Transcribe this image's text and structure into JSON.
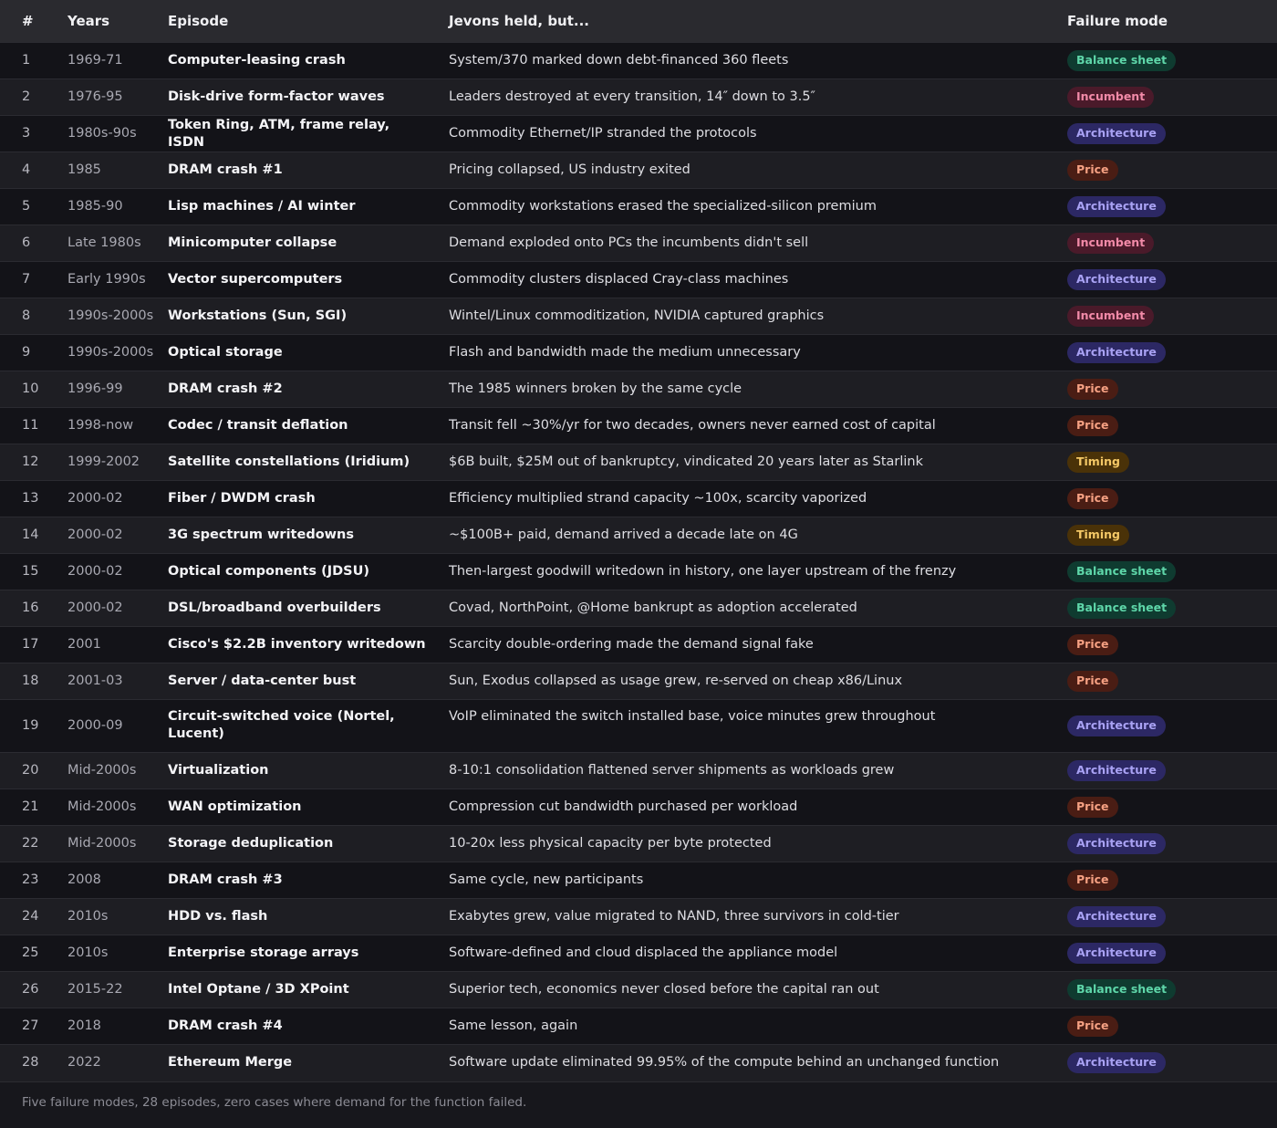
{
  "headers": {
    "num": "#",
    "years": "Years",
    "episode": "Episode",
    "desc": "Jevons held, but...",
    "mode": "Failure mode"
  },
  "colors": {
    "balance_sheet": "#5ed6a9",
    "incumbent": "#f28aa8",
    "architecture": "#a9a2f4",
    "price": "#f5a082",
    "timing": "#f4c866"
  },
  "rows": [
    {
      "num": "1",
      "years": "1969-71",
      "episode": "Computer-leasing crash",
      "desc": "System/370 marked down debt-financed 360 fleets",
      "mode": "Balance sheet",
      "mode_key": "balance"
    },
    {
      "num": "2",
      "years": "1976-95",
      "episode": "Disk-drive form-factor waves",
      "desc": "Leaders destroyed at every transition, 14″ down to 3.5″",
      "mode": "Incumbent",
      "mode_key": "incumbent"
    },
    {
      "num": "3",
      "years": "1980s-90s",
      "episode": "Token Ring, ATM, frame relay, ISDN",
      "desc": "Commodity Ethernet/IP stranded the protocols",
      "mode": "Architecture",
      "mode_key": "architecture"
    },
    {
      "num": "4",
      "years": "1985",
      "episode": "DRAM crash #1",
      "desc": "Pricing collapsed, US industry exited",
      "mode": "Price",
      "mode_key": "price"
    },
    {
      "num": "5",
      "years": "1985-90",
      "episode": "Lisp machines / AI winter",
      "desc": "Commodity workstations erased the specialized-silicon premium",
      "mode": "Architecture",
      "mode_key": "architecture"
    },
    {
      "num": "6",
      "years": "Late 1980s",
      "episode": "Minicomputer collapse",
      "desc": "Demand exploded onto PCs the incumbents didn't sell",
      "mode": "Incumbent",
      "mode_key": "incumbent"
    },
    {
      "num": "7",
      "years": "Early 1990s",
      "episode": "Vector supercomputers",
      "desc": "Commodity clusters displaced Cray-class machines",
      "mode": "Architecture",
      "mode_key": "architecture"
    },
    {
      "num": "8",
      "years": "1990s-2000s",
      "episode": "Workstations (Sun, SGI)",
      "desc": "Wintel/Linux commoditization, NVIDIA captured graphics",
      "mode": "Incumbent",
      "mode_key": "incumbent"
    },
    {
      "num": "9",
      "years": "1990s-2000s",
      "episode": "Optical storage",
      "desc": "Flash and bandwidth made the medium unnecessary",
      "mode": "Architecture",
      "mode_key": "architecture"
    },
    {
      "num": "10",
      "years": "1996-99",
      "episode": "DRAM crash #2",
      "desc": "The 1985 winners broken by the same cycle",
      "mode": "Price",
      "mode_key": "price"
    },
    {
      "num": "11",
      "years": "1998-now",
      "episode": "Codec / transit deflation",
      "desc": "Transit fell ~30%/yr for two decades, owners never earned cost of capital",
      "mode": "Price",
      "mode_key": "price"
    },
    {
      "num": "12",
      "years": "1999-2002",
      "episode": "Satellite constellations (Iridium)",
      "desc": "$6B built, $25M out of bankruptcy, vindicated 20 years later as Starlink",
      "mode": "Timing",
      "mode_key": "timing"
    },
    {
      "num": "13",
      "years": "2000-02",
      "episode": "Fiber / DWDM crash",
      "desc": "Efficiency multiplied strand capacity ~100x, scarcity vaporized",
      "mode": "Price",
      "mode_key": "price"
    },
    {
      "num": "14",
      "years": "2000-02",
      "episode": "3G spectrum writedowns",
      "desc": "~$100B+ paid, demand arrived a decade late on 4G",
      "mode": "Timing",
      "mode_key": "timing"
    },
    {
      "num": "15",
      "years": "2000-02",
      "episode": "Optical components (JDSU)",
      "desc": "Then-largest goodwill writedown in history, one layer upstream of the frenzy",
      "mode": "Balance sheet",
      "mode_key": "balance"
    },
    {
      "num": "16",
      "years": "2000-02",
      "episode": "DSL/broadband overbuilders",
      "desc": "Covad, NorthPoint, @Home bankrupt as adoption accelerated",
      "mode": "Balance sheet",
      "mode_key": "balance"
    },
    {
      "num": "17",
      "years": "2001",
      "episode": "Cisco's $2.2B inventory writedown",
      "desc": "Scarcity double-ordering made the demand signal fake",
      "mode": "Price",
      "mode_key": "price"
    },
    {
      "num": "18",
      "years": "2001-03",
      "episode": "Server / data-center bust",
      "desc": "Sun, Exodus collapsed as usage grew, re-served on cheap x86/Linux",
      "mode": "Price",
      "mode_key": "price"
    },
    {
      "num": "19",
      "years": "2000-09",
      "episode": "Circuit-switched voice (Nortel, Lucent)",
      "desc": "VoIP eliminated the switch installed base, voice minutes grew throughout",
      "mode": "Architecture",
      "mode_key": "architecture",
      "tall": true
    },
    {
      "num": "20",
      "years": "Mid-2000s",
      "episode": "Virtualization",
      "desc": "8-10:1 consolidation flattened server shipments as workloads grew",
      "mode": "Architecture",
      "mode_key": "architecture"
    },
    {
      "num": "21",
      "years": "Mid-2000s",
      "episode": "WAN optimization",
      "desc": "Compression cut bandwidth purchased per workload",
      "mode": "Price",
      "mode_key": "price"
    },
    {
      "num": "22",
      "years": "Mid-2000s",
      "episode": "Storage deduplication",
      "desc": "10-20x less physical capacity per byte protected",
      "mode": "Architecture",
      "mode_key": "architecture"
    },
    {
      "num": "23",
      "years": "2008",
      "episode": "DRAM crash #3",
      "desc": "Same cycle, new participants",
      "mode": "Price",
      "mode_key": "price"
    },
    {
      "num": "24",
      "years": "2010s",
      "episode": "HDD vs. flash",
      "desc": "Exabytes grew, value migrated to NAND, three survivors in cold-tier",
      "mode": "Architecture",
      "mode_key": "architecture"
    },
    {
      "num": "25",
      "years": "2010s",
      "episode": "Enterprise storage arrays",
      "desc": "Software-defined and cloud displaced the appliance model",
      "mode": "Architecture",
      "mode_key": "architecture"
    },
    {
      "num": "26",
      "years": "2015-22",
      "episode": "Intel Optane / 3D XPoint",
      "desc": "Superior tech, economics never closed before the capital ran out",
      "mode": "Balance sheet",
      "mode_key": "balance"
    },
    {
      "num": "27",
      "years": "2018",
      "episode": "DRAM crash #4",
      "desc": "Same lesson, again",
      "mode": "Price",
      "mode_key": "price"
    },
    {
      "num": "28",
      "years": "2022",
      "episode": "Ethereum Merge",
      "desc": "Software update eliminated 99.95% of the compute behind an unchanged function",
      "mode": "Architecture",
      "mode_key": "architecture"
    }
  ],
  "footer": "Five failure modes, 28 episodes, zero cases where demand for the function failed."
}
